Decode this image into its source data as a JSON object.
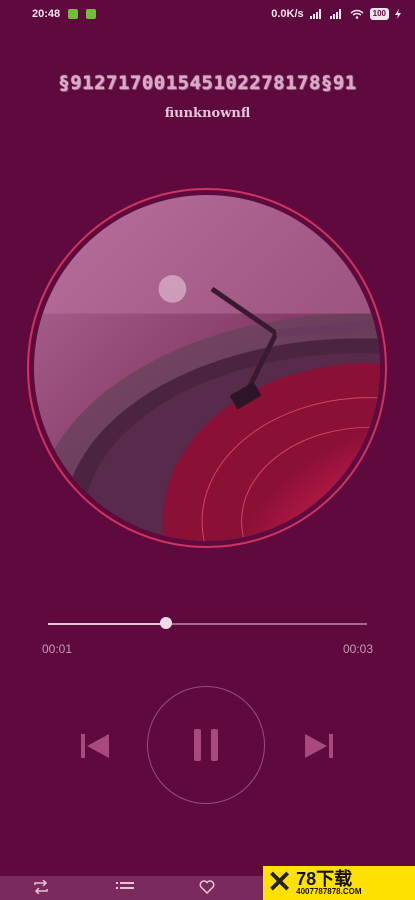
{
  "status_bar": {
    "time": "20:48",
    "network_speed": "0.0K/s",
    "battery": "100"
  },
  "song": {
    "title": "§912717001545102278178§91",
    "artist": "fiunknownfl"
  },
  "player": {
    "current_time": "00:01",
    "total_time": "00:03",
    "progress_fraction": 0.37,
    "state": "playing"
  },
  "watermark": {
    "brand": "78下载",
    "phone": "4007787878.COM"
  },
  "colors": {
    "background": "#5e0a3f",
    "disc_border": "#d0345f",
    "accent": "#d81b60"
  },
  "icons": {
    "prev": "skip-previous-icon",
    "play_pause": "pause-icon",
    "next": "skip-next-icon",
    "repeat": "repeat-icon",
    "playlist": "playlist-icon",
    "favorite": "heart-icon"
  }
}
